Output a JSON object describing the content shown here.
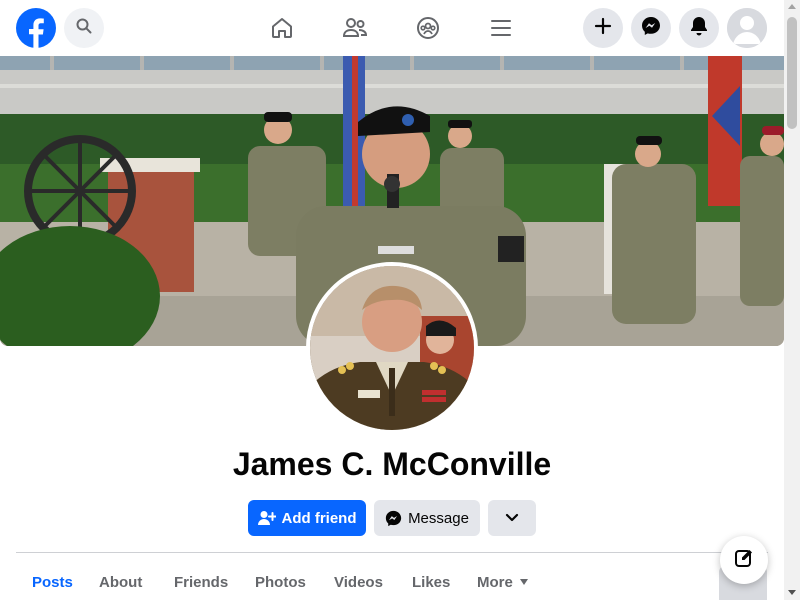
{
  "nav": {
    "logo_icon": "facebook-logo-icon",
    "search_icon": "search-icon",
    "center_icons": [
      "home-icon",
      "friends-icon",
      "groups-icon",
      "menu-icon"
    ],
    "right_icons": [
      "plus-icon",
      "messenger-icon",
      "bell-icon",
      "avatar-icon"
    ],
    "brand_color": "#0866ff"
  },
  "profile": {
    "name": "James C. McConville",
    "add_friend_label": "Add friend",
    "message_label": "Message"
  },
  "tabs": [
    {
      "label": "Posts",
      "active": true
    },
    {
      "label": "About",
      "active": false
    },
    {
      "label": "Friends",
      "active": false
    },
    {
      "label": "Photos",
      "active": false
    },
    {
      "label": "Videos",
      "active": false
    },
    {
      "label": "Likes",
      "active": false
    },
    {
      "label": "More",
      "active": false
    }
  ]
}
